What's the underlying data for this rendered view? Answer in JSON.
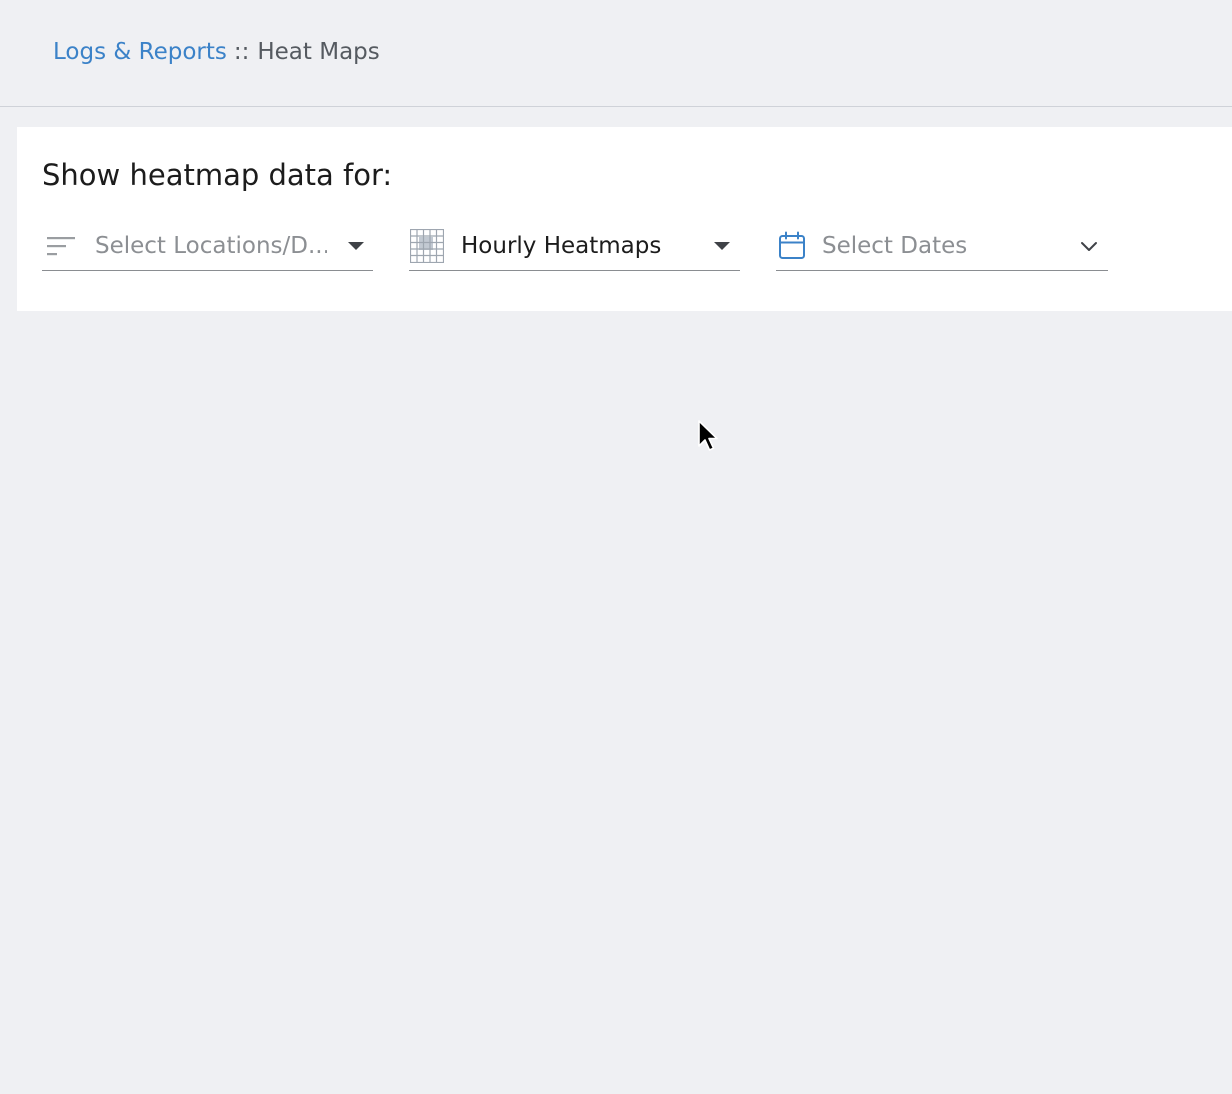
{
  "breadcrumb": {
    "parent": "Logs & Reports",
    "separator": "::",
    "current": "Heat Maps"
  },
  "panel": {
    "title": "Show heatmap data for:"
  },
  "filters": {
    "locations": {
      "value": "Select Locations/D...",
      "icon": "filter-lines-icon",
      "caret": "triangle-down-icon"
    },
    "heatmap_type": {
      "value": "Hourly Heatmaps",
      "icon": "grid-icon",
      "caret": "triangle-down-icon"
    },
    "dates": {
      "value": "Select Dates",
      "icon": "calendar-icon",
      "caret": "chevron-down-icon"
    }
  },
  "colors": {
    "background": "#eff0f3",
    "link": "#3b82c8",
    "calendar_icon": "#3b82c8",
    "placeholder_text": "#8c8f93"
  }
}
